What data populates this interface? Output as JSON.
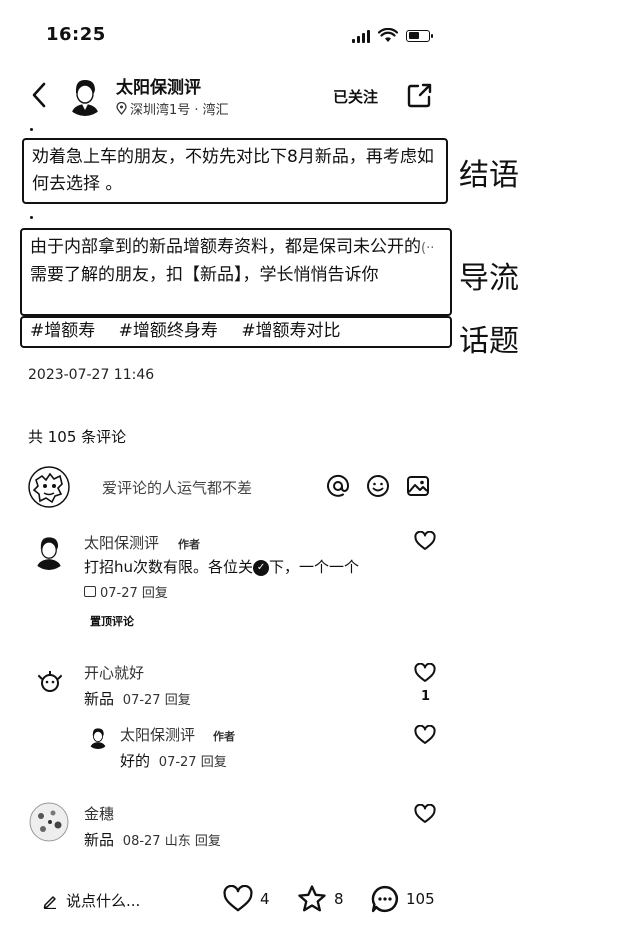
{
  "status": {
    "time": "16:25"
  },
  "header": {
    "author": "太阳保测评",
    "location": "深圳湾1号 · 湾汇",
    "follow_label": "已关注"
  },
  "post": {
    "box1_text": "劝着急上车的朋友，不妨先对比下8月新品，再考虑如何去选择 。",
    "box2_line1": "由于内部拿到的新品增额寿资料，都是保司未公开的",
    "box2_line2": "需要了解的朋友，扣【新品】，学长悄悄告诉你",
    "tags": [
      "#增额寿",
      "#增额终身寿",
      "#增额寿对比"
    ],
    "date": "2023-07-27 11:46"
  },
  "annotations": {
    "label1": "结语",
    "label2": "导流",
    "label3": "话题"
  },
  "comments": {
    "count_label": "共 105 条评论",
    "input_placeholder": "爱评论的人运气都不差",
    "items": [
      {
        "name": "太阳保测评",
        "badge": "作者",
        "text": "打招hu次数有限。各位关",
        "text_tail": "下，一个一个",
        "meta": "07-27 回复",
        "pin": "置顶评论"
      },
      {
        "name": "开心就好",
        "text": "新品",
        "meta": "07-27 回复",
        "likes": "1"
      },
      {
        "name": "太阳保测评",
        "badge": "作者",
        "text": "好的",
        "meta": "07-27 回复"
      },
      {
        "name": "金穗",
        "text": "新品",
        "meta": "08-27 山东 回复"
      }
    ]
  },
  "bottom": {
    "say_label": "说点什么...",
    "likes": "4",
    "stars": "8",
    "comments": "105"
  }
}
